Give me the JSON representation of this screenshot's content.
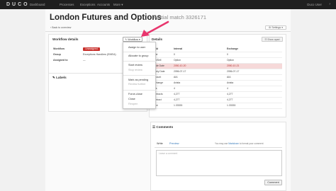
{
  "nav": {
    "logo": "DUCO",
    "items": [
      "Dashboard",
      "Processes",
      "Exceptions",
      "Accounts",
      "More ▾"
    ],
    "user": "Duco User",
    "arrow": "›"
  },
  "header": {
    "title": "London Futures and Options",
    "subtitle": "Partial match 3326171",
    "settings_label": "⚙ Settings ▾",
    "back_label": "‹ Back to overview"
  },
  "workflow": {
    "title": "Workflow details",
    "button_label": "✎ Workflow ▾",
    "rows": [
      {
        "label": "Workflow",
        "value": "Unassigned"
      },
      {
        "label": "Group",
        "value": "Exceptions Handlers (EMEA)"
      },
      {
        "label": "Assigned to",
        "value": "—"
      }
    ],
    "status_color": "#c9302c"
  },
  "labels_panel": {
    "title": "✎ Labels"
  },
  "menu": {
    "items": [
      {
        "label": "Assign to user",
        "disabled": false
      },
      {
        "label": "Allocate to group",
        "disabled": false
      },
      {
        "label": "Start review",
        "disabled": false
      },
      {
        "label": "Stop review",
        "disabled": true
      },
      {
        "label": "Mark as pending",
        "disabled": false
      },
      {
        "label": "Review further",
        "disabled": true
      },
      {
        "label": "Force-close",
        "disabled": false
      },
      {
        "label": "Close",
        "disabled": false
      },
      {
        "label": "Reopen",
        "disabled": true
      }
    ]
  },
  "details": {
    "title": "Details",
    "show_all_label": "☷ Show apart",
    "columns": [
      "Field",
      "Internal",
      "Exchange"
    ],
    "rows": [
      {
        "field": "Type",
        "internal": "0",
        "exchange": "0",
        "highlight": false
      },
      {
        "field": "Buy/Sell",
        "internal": "Option",
        "exchange": "Option",
        "highlight": false
      },
      {
        "field": "Trade Date",
        "internal": "2050-10-20",
        "exchange": "2050-10-21",
        "highlight": true
      },
      {
        "field": "Expiry Date",
        "internal": "2056-07-17",
        "exchange": "2056-07-17",
        "highlight": false
      },
      {
        "field": "Account",
        "internal": "AIA",
        "exchange": "AIA",
        "highlight": false
      },
      {
        "field": "Exchange",
        "internal": "Avista",
        "exchange": "Avista",
        "highlight": false
      },
      {
        "field": "Lots",
        "internal": "4",
        "exchange": "4",
        "highlight": false
      },
      {
        "field": "Contracts",
        "internal": "4,277",
        "exchange": "4,277",
        "highlight": false
      },
      {
        "field": "Contract",
        "internal": "4,277",
        "exchange": "4,277",
        "highlight": false
      },
      {
        "field": "Price",
        "internal": "1.33333",
        "exchange": "1.33333",
        "highlight": false
      }
    ]
  },
  "comments": {
    "title": "☰ Comments",
    "tab_write": "Write",
    "tab_preview": "Preview",
    "hint_prefix": "You may use",
    "hint_link": "Markdown",
    "hint_suffix": "to format your comment",
    "placeholder": "Leave a comment",
    "button_label": "Comment"
  },
  "colors": {
    "nav_bg": "#1f1f1f",
    "highlight_row": "#f6d9d9",
    "arrow": "#e8356d",
    "link": "#3478b8"
  }
}
